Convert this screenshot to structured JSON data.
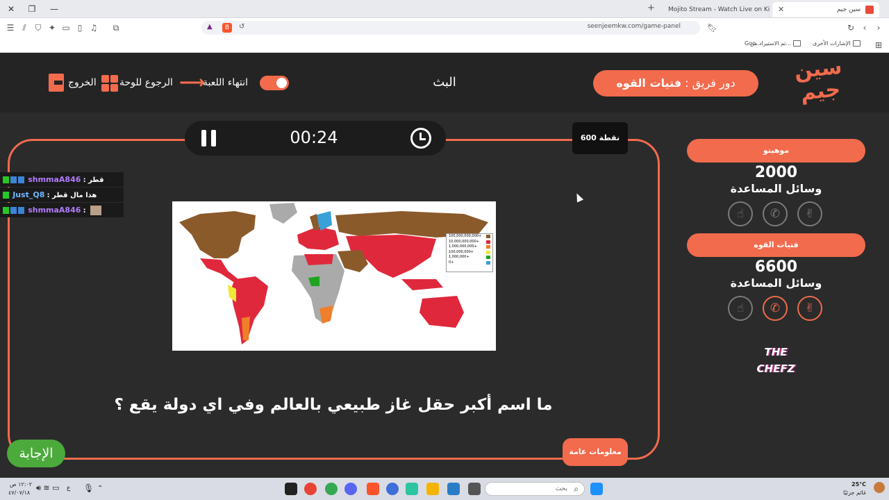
{
  "browser": {
    "tabs": [
      {
        "title": "سين جيم"
      },
      {
        "title": "Mojito Stream - Watch Live on Kick"
      }
    ],
    "url": "seenjeemkw.com/game-panel",
    "bookmarks": [
      "الإشارات الأخرى",
      "تم الاستيراد من...",
      "Goo..."
    ]
  },
  "header": {
    "logo_text": "سين جيم",
    "turn_prefix": "دور فريق :",
    "turn_team": "فتيات القوه",
    "live_label": "البث",
    "end_game_label": "انتهاء اللعبة",
    "back_to_board_label": "الرجوع للوحة",
    "exit_label": "الخروج"
  },
  "game": {
    "timer": "00:24",
    "points": "600 نقطة",
    "question": "ما اسم أكبر حقل غاز طبيعي بالعالم وفي اي دولة يقع ؟",
    "category": "معلومات عامة",
    "answer_label": "الإجابة",
    "map_legend": [
      "100,000,000,000+",
      "10,000,000,000+",
      "1,000,000,000+",
      "100,000,000+",
      "1,000,000+",
      "0+"
    ],
    "legend_colors": [
      "#8b5a2b",
      "#e0283c",
      "#ef7f2a",
      "#f0e832",
      "#1ea51e",
      "#3aa0d8"
    ]
  },
  "chat": [
    {
      "user": "shmmaA846",
      "message": "قطر"
    },
    {
      "user": "Just_Q8",
      "message": "هذا مال قطر"
    },
    {
      "user": "shmmaA846",
      "message": ""
    }
  ],
  "teams": [
    {
      "name": "موهيتو",
      "score": "2000",
      "aids_label": "وسائل المساعدة",
      "aids": [
        {
          "icon": "hands-icon",
          "active": false
        },
        {
          "icon": "phone-icon",
          "active": false
        },
        {
          "icon": "two-fingers-icon",
          "active": false
        }
      ]
    },
    {
      "name": "فتيات القوه",
      "score": "6600",
      "aids_label": "وسائل المساعدة",
      "aids": [
        {
          "icon": "hands-icon",
          "active": false
        },
        {
          "icon": "phone-icon",
          "active": true
        },
        {
          "icon": "two-fingers-icon",
          "active": true
        }
      ]
    }
  ],
  "sponsor": "THE CHEFZ",
  "taskbar": {
    "search_placeholder": "بحث",
    "weather_temp": "25°C",
    "weather_desc": "غائم جزئيًا",
    "time": "١٢:٠٢ ص",
    "date": "٤٧/٠٧/١٨",
    "lang": "ع"
  },
  "colors": {
    "accent": "#f26b4d",
    "background": "#2b2b2b",
    "header": "#242424",
    "answer": "#4caa3c"
  }
}
